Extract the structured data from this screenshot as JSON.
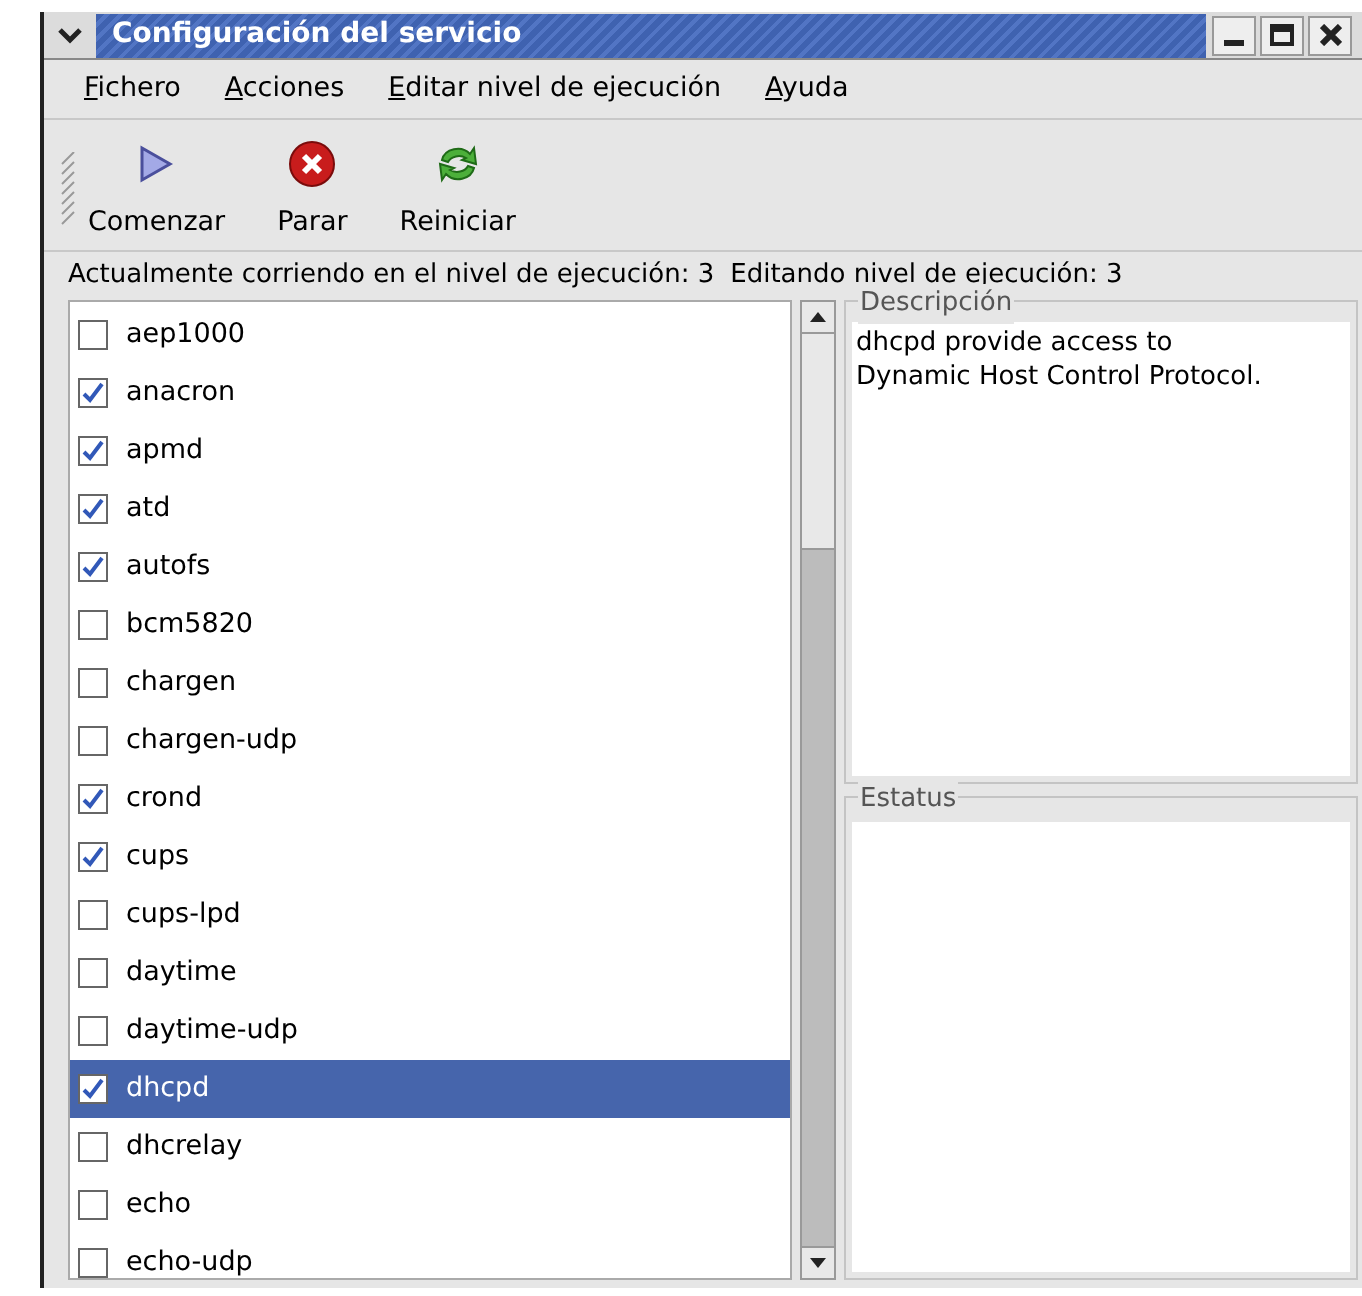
{
  "window": {
    "title": "Configuración del servicio"
  },
  "menu": [
    {
      "mnemonic": "F",
      "rest": "ichero"
    },
    {
      "mnemonic": "A",
      "rest": "cciones"
    },
    {
      "mnemonic": "E",
      "rest": "ditar nivel de ejecución"
    },
    {
      "mnemonic": "A",
      "rest": "yuda"
    }
  ],
  "toolbar": [
    {
      "label": "Comenzar",
      "kind": "start"
    },
    {
      "label": "Parar",
      "kind": "stop"
    },
    {
      "label": "Reiniciar",
      "kind": "restart"
    }
  ],
  "status_left": "Actualmente corriendo en el nivel de ejecución: 3",
  "status_right": "Editando nivel de ejecución: 3",
  "services": [
    {
      "name": "aep1000",
      "checked": false,
      "selected": false
    },
    {
      "name": "anacron",
      "checked": true,
      "selected": false
    },
    {
      "name": "apmd",
      "checked": true,
      "selected": false
    },
    {
      "name": "atd",
      "checked": true,
      "selected": false
    },
    {
      "name": "autofs",
      "checked": true,
      "selected": false
    },
    {
      "name": "bcm5820",
      "checked": false,
      "selected": false
    },
    {
      "name": "chargen",
      "checked": false,
      "selected": false
    },
    {
      "name": "chargen-udp",
      "checked": false,
      "selected": false
    },
    {
      "name": "crond",
      "checked": true,
      "selected": false
    },
    {
      "name": "cups",
      "checked": true,
      "selected": false
    },
    {
      "name": "cups-lpd",
      "checked": false,
      "selected": false
    },
    {
      "name": "daytime",
      "checked": false,
      "selected": false
    },
    {
      "name": "daytime-udp",
      "checked": false,
      "selected": false
    },
    {
      "name": "dhcpd",
      "checked": true,
      "selected": true
    },
    {
      "name": "dhcrelay",
      "checked": false,
      "selected": false
    },
    {
      "name": "echo",
      "checked": false,
      "selected": false
    },
    {
      "name": "echo-udp",
      "checked": false,
      "selected": false
    }
  ],
  "description": {
    "title": "Descripción",
    "text": "dhcpd provide access to Dynamic Host Control Protocol."
  },
  "status": {
    "title": "Estatus"
  }
}
